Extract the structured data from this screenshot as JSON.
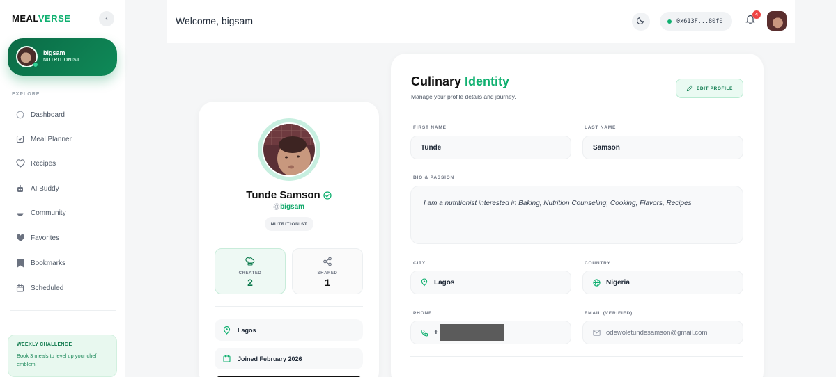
{
  "brand": {
    "logo_left": "MEAL",
    "logo_right": "VERSE"
  },
  "sidebar": {
    "user": {
      "name": "bigsam",
      "role": "NUTRITIONIST"
    },
    "section_label": "EXPLORE",
    "items": [
      {
        "label": "Dashboard",
        "icon": "dashboard-icon"
      },
      {
        "label": "Meal Planner",
        "icon": "meal-planner-icon"
      },
      {
        "label": "Recipes",
        "icon": "heart-outline-icon"
      },
      {
        "label": "AI Buddy",
        "icon": "ai-buddy-icon"
      },
      {
        "label": "Community",
        "icon": "community-icon"
      },
      {
        "label": "Favorites",
        "icon": "heart-filled-icon"
      },
      {
        "label": "Bookmarks",
        "icon": "bookmark-icon"
      },
      {
        "label": "Scheduled",
        "icon": "calendar-icon"
      }
    ],
    "challenge": {
      "title": "WEEKLY CHALLENGE",
      "text": "Book 3 meals to level up your chef emblem!"
    }
  },
  "header": {
    "welcome": "Welcome, bigsam",
    "wallet": "0x613F...80f0",
    "notification_count": "4"
  },
  "profile": {
    "full_name": "Tunde Samson",
    "at": "@",
    "handle": "bigsam",
    "role": "NUTRITIONIST",
    "stats": [
      {
        "label": "CREATED",
        "value": "2"
      },
      {
        "label": "SHARED",
        "value": "1"
      }
    ],
    "location": "Lagos",
    "joined": "Joined February 2026"
  },
  "identity": {
    "title_main": "Culinary ",
    "title_accent": "Identity",
    "subtitle": "Manage your profile details and journey.",
    "edit_label": "EDIT PROFILE",
    "fields": {
      "first_name": {
        "label": "FIRST NAME",
        "value": "Tunde"
      },
      "last_name": {
        "label": "LAST NAME",
        "value": "Samson"
      },
      "bio": {
        "label": "BIO & PASSION",
        "value": "I am a nutritionist interested in Baking, Nutrition Counseling, Cooking, Flavors, Recipes"
      },
      "city": {
        "label": "CITY",
        "value": "Lagos"
      },
      "country": {
        "label": "COUNTRY",
        "value": "Nigeria"
      },
      "phone": {
        "label": "PHONE",
        "value": "+"
      },
      "email": {
        "label": "EMAIL (VERIFIED)",
        "value": "odewoletundesamson@gmail.com"
      }
    }
  },
  "colors": {
    "accent": "#10b070",
    "accent_dark": "#0b6b46",
    "badge": "#ef4444"
  }
}
